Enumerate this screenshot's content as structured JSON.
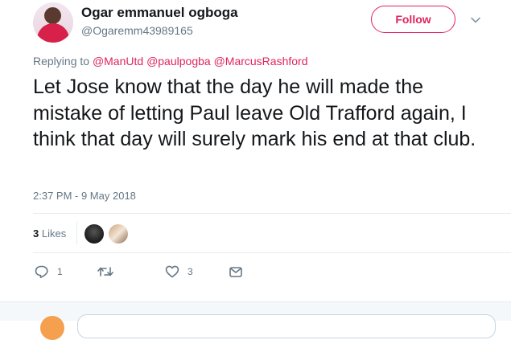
{
  "header": {
    "display_name": "Ogar emmanuel ogboga",
    "handle": "@Ogaremm43989165",
    "follow_label": "Follow",
    "avatar_icon": "user-avatar",
    "menu_icon": "chevron-down-icon"
  },
  "replying": {
    "prefix": "Replying to",
    "mentions": [
      "@ManUtd",
      "@paulpogba",
      "@MarcusRashford"
    ]
  },
  "tweet": {
    "text": "Let Jose know that the day he will made the mistake of letting Paul leave Old Trafford again, I think that day will surely mark his end at that club.",
    "timestamp": "2:37 PM - 9 May 2018"
  },
  "stats": {
    "likes_count": "3",
    "likes_label": "Likes"
  },
  "actions": {
    "reply_count": "1",
    "retweet_count": "",
    "like_count": "3"
  },
  "colors": {
    "accent": "#e0245e",
    "secondary_text": "#657786",
    "divider": "#e6ecf0"
  }
}
